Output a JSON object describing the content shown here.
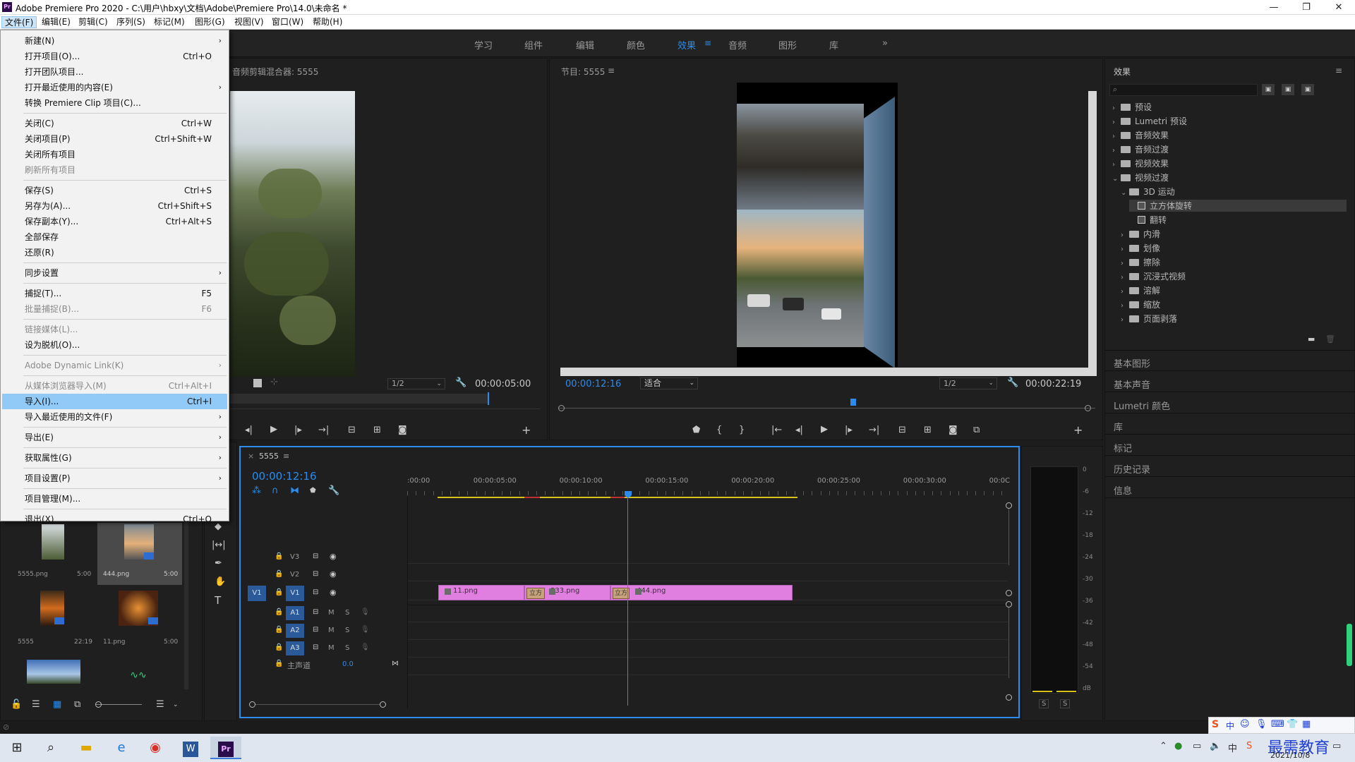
{
  "window": {
    "title": "Adobe Premiere Pro 2020 - C:\\用户\\hbxy\\文档\\Adobe\\Premiere Pro\\14.0\\未命名 *",
    "app_icon": "Pr",
    "controls": [
      "—",
      "❐",
      "✕"
    ]
  },
  "menubar": [
    "文件(F)",
    "编辑(E)",
    "剪辑(C)",
    "序列(S)",
    "标记(M)",
    "图形(G)",
    "视图(V)",
    "窗口(W)",
    "帮助(H)"
  ],
  "workspaces": [
    "学习",
    "组件",
    "编辑",
    "颜色",
    "效果",
    "音频",
    "图形",
    "库"
  ],
  "workspace_more": "»",
  "file_menu": [
    {
      "label": "新建(N)",
      "shortcut": "",
      "submenu": true,
      "disabled": false
    },
    {
      "label": "打开项目(O)...",
      "shortcut": "Ctrl+O",
      "submenu": false,
      "disabled": false
    },
    {
      "label": "打开团队项目...",
      "shortcut": "",
      "submenu": false,
      "disabled": false
    },
    {
      "label": "打开最近使用的内容(E)",
      "shortcut": "",
      "submenu": true,
      "disabled": false
    },
    {
      "label": "转换 Premiere Clip 项目(C)...",
      "shortcut": "",
      "submenu": false,
      "disabled": false
    },
    {
      "label": "关闭(C)",
      "shortcut": "Ctrl+W",
      "submenu": false,
      "disabled": false
    },
    {
      "label": "关闭项目(P)",
      "shortcut": "Ctrl+Shift+W",
      "submenu": false,
      "disabled": false
    },
    {
      "label": "关闭所有项目",
      "shortcut": "",
      "submenu": false,
      "disabled": false
    },
    {
      "label": "刷新所有项目",
      "shortcut": "",
      "submenu": false,
      "disabled": true
    },
    {
      "label": "保存(S)",
      "shortcut": "Ctrl+S",
      "submenu": false,
      "disabled": false
    },
    {
      "label": "另存为(A)...",
      "shortcut": "Ctrl+Shift+S",
      "submenu": false,
      "disabled": false
    },
    {
      "label": "保存副本(Y)...",
      "shortcut": "Ctrl+Alt+S",
      "submenu": false,
      "disabled": false
    },
    {
      "label": "全部保存",
      "shortcut": "",
      "submenu": false,
      "disabled": false
    },
    {
      "label": "还原(R)",
      "shortcut": "",
      "submenu": false,
      "disabled": false
    },
    {
      "label": "同步设置",
      "shortcut": "",
      "submenu": true,
      "disabled": false
    },
    {
      "label": "捕捉(T)...",
      "shortcut": "F5",
      "submenu": false,
      "disabled": false
    },
    {
      "label": "批量捕捉(B)...",
      "shortcut": "F6",
      "submenu": false,
      "disabled": true
    },
    {
      "label": "链接媒体(L)...",
      "shortcut": "",
      "submenu": false,
      "disabled": true
    },
    {
      "label": "设为脱机(O)...",
      "shortcut": "",
      "submenu": false,
      "disabled": false
    },
    {
      "label": "Adobe Dynamic Link(K)",
      "shortcut": "",
      "submenu": true,
      "disabled": true
    },
    {
      "label": "从媒体浏览器导入(M)",
      "shortcut": "Ctrl+Alt+I",
      "submenu": false,
      "disabled": true
    },
    {
      "label": "导入(I)...",
      "shortcut": "Ctrl+I",
      "submenu": false,
      "disabled": false,
      "highlighted": true
    },
    {
      "label": "导入最近使用的文件(F)",
      "shortcut": "",
      "submenu": true,
      "disabled": false
    },
    {
      "label": "导出(E)",
      "shortcut": "",
      "submenu": true,
      "disabled": false
    },
    {
      "label": "获取属性(G)",
      "shortcut": "",
      "submenu": true,
      "disabled": false
    },
    {
      "label": "项目设置(P)",
      "shortcut": "",
      "submenu": true,
      "disabled": false
    },
    {
      "label": "项目管理(M)...",
      "shortcut": "",
      "submenu": false,
      "disabled": false
    },
    {
      "label": "退出(X)",
      "shortcut": "Ctrl+Q",
      "submenu": false,
      "disabled": false
    }
  ],
  "source_panel": {
    "title": "音频剪辑混合器: 5555",
    "resolution": "1/2",
    "timecode": "00:00:05:00"
  },
  "program_panel": {
    "title": "节目: 5555",
    "current_time": "00:00:12:16",
    "fit": "适合",
    "resolution": "1/2",
    "duration": "00:00:22:19"
  },
  "timeline": {
    "sequence": "5555",
    "current_time": "00:00:12:16",
    "ruler": [
      ":00:00",
      "00:00:05:00",
      "00:00:10:00",
      "00:00:15:00",
      "00:00:20:00",
      "00:00:25:00",
      "00:00:30:00",
      "00:0C"
    ],
    "video_tracks": [
      "V3",
      "V2",
      "V1"
    ],
    "audio_tracks": [
      "A1",
      "A2",
      "A3"
    ],
    "source_patch": "V1",
    "master_label": "主声道",
    "master_value": "0.0",
    "clips": [
      {
        "name": "11.png"
      },
      {
        "name": "333.png"
      },
      {
        "name": "444.png"
      }
    ],
    "transitions": [
      "立方",
      "立方"
    ],
    "track_buttons": {
      "mute": "M",
      "solo": "S"
    }
  },
  "project_bin": {
    "items": [
      {
        "name": "5555.png",
        "duration": "5:00"
      },
      {
        "name": "444.png",
        "duration": "5:00"
      },
      {
        "name": "5555",
        "duration": "22:19"
      },
      {
        "name": "11.png",
        "duration": "5:00"
      }
    ]
  },
  "effects_panel": {
    "title": "效果",
    "tree": [
      {
        "label": "预设",
        "level": 0,
        "expanded": false
      },
      {
        "label": "Lumetri 预设",
        "level": 0,
        "expanded": false
      },
      {
        "label": "音频效果",
        "level": 0,
        "expanded": false
      },
      {
        "label": "音频过渡",
        "level": 0,
        "expanded": false
      },
      {
        "label": "视频效果",
        "level": 0,
        "expanded": false
      },
      {
        "label": "视频过渡",
        "level": 0,
        "expanded": true
      },
      {
        "label": "3D 运动",
        "level": 1,
        "expanded": true
      },
      {
        "label": "立方体旋转",
        "level": 2,
        "selected": true
      },
      {
        "label": "翻转",
        "level": 2
      },
      {
        "label": "内滑",
        "level": 1,
        "expanded": false
      },
      {
        "label": "划像",
        "level": 1,
        "expanded": false
      },
      {
        "label": "擦除",
        "level": 1,
        "expanded": false
      },
      {
        "label": "沉浸式视频",
        "level": 1,
        "expanded": false
      },
      {
        "label": "溶解",
        "level": 1,
        "expanded": false
      },
      {
        "label": "缩放",
        "level": 1,
        "expanded": false
      },
      {
        "label": "页面剥落",
        "level": 1,
        "expanded": false
      }
    ],
    "collapsed_panels": [
      "基本图形",
      "基本声音",
      "Lumetri 颜色",
      "库",
      "标记",
      "历史记录",
      "信息"
    ]
  },
  "audio_meter": {
    "scale": [
      "0",
      "-6",
      "-12",
      "-18",
      "-24",
      "-30",
      "-36",
      "-42",
      "-48",
      "-54",
      "dB"
    ],
    "solo": [
      "S",
      "S"
    ]
  },
  "taskbar": {
    "date": "2021/10/8",
    "watermark": "最需教育",
    "ime": "中"
  },
  "colors": {
    "accent": "#2d8ceb",
    "clip": "#e07fe0",
    "highlight": "#91c9f7",
    "playhead": "#2d8ceb"
  }
}
